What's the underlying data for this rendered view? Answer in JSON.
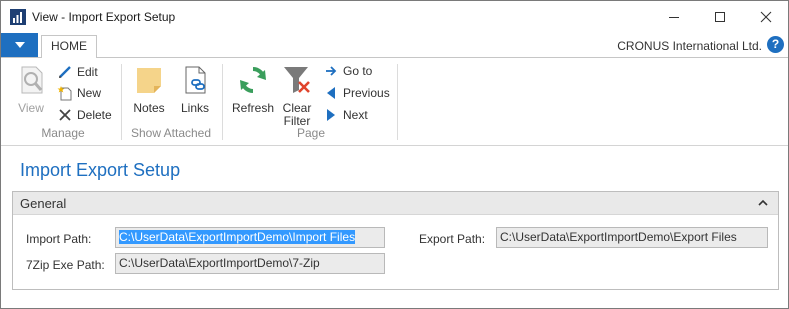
{
  "window": {
    "title": "View - Import Export Setup",
    "company": "CRONUS International Ltd.",
    "help_glyph": "?",
    "file_menu_icon": "triangle-down-icon"
  },
  "tabs": [
    {
      "label": "HOME",
      "selected": true
    }
  ],
  "ribbon": {
    "manage": {
      "label": "Manage",
      "view_label": "View",
      "edit_label": "Edit",
      "new_label": "New",
      "delete_label": "Delete"
    },
    "show_attached": {
      "label": "Show Attached",
      "notes_label": "Notes",
      "links_label": "Links"
    },
    "page": {
      "label": "Page",
      "refresh_label": "Refresh",
      "clear_filter_label_1": "Clear",
      "clear_filter_label_2": "Filter",
      "goto_label": "Go to",
      "previous_label": "Previous",
      "next_label": "Next"
    }
  },
  "page": {
    "title": "Import Export Setup"
  },
  "general": {
    "title": "General",
    "import_path_label": "Import Path:",
    "import_path_value": "C:\\UserData\\ExportImportDemo\\Import Files",
    "zip_exe_path_label": "7Zip Exe Path:",
    "zip_exe_path_value": "C:\\UserData\\ExportImportDemo\\7-Zip",
    "export_path_label": "Export Path:",
    "export_path_value": "C:\\UserData\\ExportImportDemo\\Export Files"
  },
  "colors": {
    "accent": "#1e6fc0",
    "field_bg": "#ebebeb",
    "header_bg": "#e9e9e9",
    "selection": "#3399ff"
  }
}
